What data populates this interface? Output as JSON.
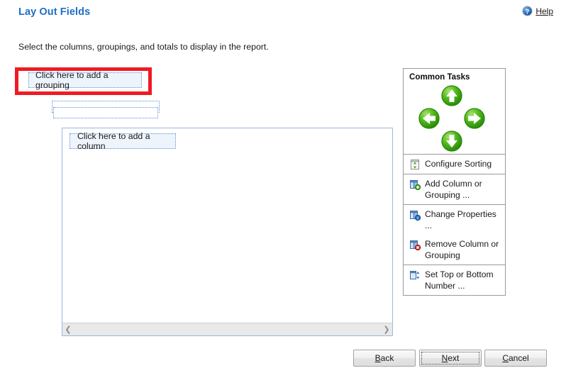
{
  "header": {
    "title": "Lay Out Fields",
    "help_label": "Help",
    "help_icon": "help-question-circle-icon"
  },
  "instruction": "Select the columns, groupings, and totals to display in the report.",
  "design_surface": {
    "grouping_placeholder": "Click here to add a grouping",
    "grouping_empty_rows": [
      "",
      ""
    ],
    "column_placeholder": "Click here to add a column",
    "scroll_left_icon": "chevron-left-icon",
    "scroll_right_icon": "chevron-right-icon"
  },
  "annotation": {
    "color": "#ee1b24",
    "target": "Click here to add a grouping"
  },
  "tasks": {
    "header": "Common Tasks",
    "nav": [
      {
        "name": "move-up",
        "label": "Move Up",
        "icon": "arrow-up-circle-icon"
      },
      {
        "name": "move-left",
        "label": "Move Left",
        "icon": "arrow-left-circle-icon"
      },
      {
        "name": "move-right",
        "label": "Move Right",
        "icon": "arrow-right-circle-icon"
      },
      {
        "name": "move-down",
        "label": "Move Down",
        "icon": "arrow-down-circle-icon"
      }
    ],
    "groups": [
      {
        "items": [
          {
            "name": "configure-sorting",
            "label": "Configure Sorting",
            "icon": "sort-arrows-icon"
          }
        ]
      },
      {
        "items": [
          {
            "name": "add-column-or-grouping",
            "label": "Add Column or Grouping ...",
            "icon": "add-column-icon"
          }
        ]
      },
      {
        "items": [
          {
            "name": "change-properties",
            "label": "Change Properties ...",
            "icon": "properties-info-icon"
          },
          {
            "name": "remove-column-or-grouping",
            "label": "Remove Column or Grouping",
            "icon": "remove-column-icon"
          }
        ]
      },
      {
        "items": [
          {
            "name": "set-top-or-bottom-number",
            "label": "Set Top or Bottom Number ...",
            "icon": "top-bottom-number-icon"
          }
        ]
      }
    ]
  },
  "footer": {
    "back": {
      "pre": "",
      "accel": "B",
      "post": "ack"
    },
    "next": {
      "pre": "",
      "accel": "N",
      "post": "ext"
    },
    "cancel": {
      "pre": "",
      "accel": "C",
      "post": "ancel"
    }
  },
  "colors": {
    "title": "#1f6fc4",
    "placeholder_border": "#5b8fd4",
    "placeholder_fill": "#eef4fc",
    "panel_border": "#9cb8dd",
    "annotation": "#ee1b24",
    "nav_green": "#3fa70d"
  }
}
